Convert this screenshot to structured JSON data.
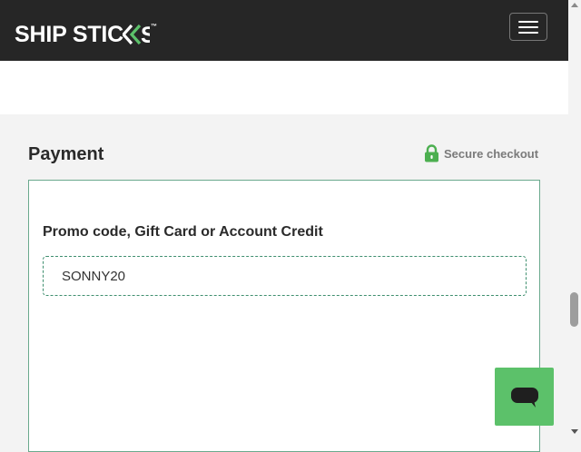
{
  "header": {
    "logo_text": "SHIP STICKS",
    "logo_main": "SHIP STIC",
    "logo_tm": "™",
    "menu_icon": "hamburger-icon"
  },
  "payment": {
    "title": "Payment",
    "secure_label": "Secure checkout",
    "secure_icon": "lock-icon",
    "promo_label": "Promo code, Gift Card or Account Credit",
    "promo_value": "SONNY20"
  },
  "chat": {
    "icon": "chat-bubble-icon"
  },
  "colors": {
    "header_bg": "#262626",
    "accent_green": "#5cc16a",
    "lock_green": "#4caf50",
    "card_border": "#6aa98d"
  }
}
